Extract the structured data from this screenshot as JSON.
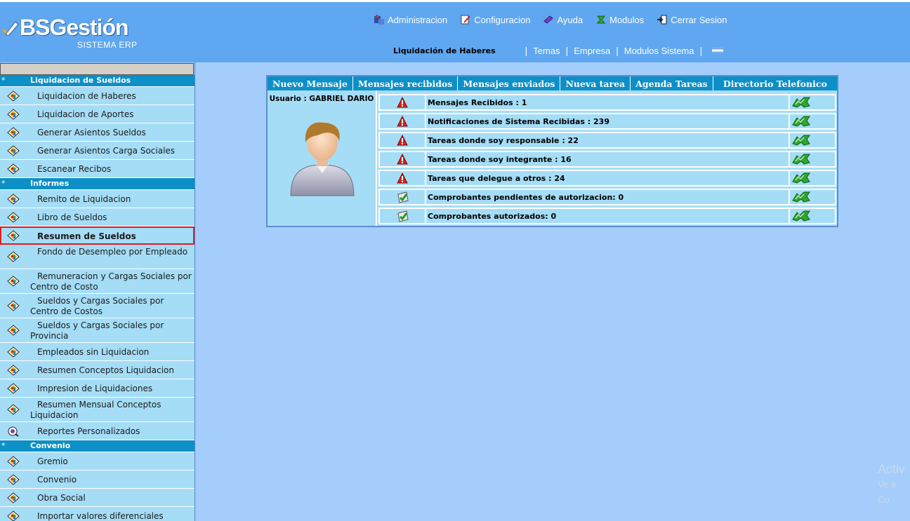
{
  "header": {
    "logo_text": "BSGestión",
    "logo_sub": "SISTEMA ERP",
    "topnav": [
      {
        "label": "Administracion",
        "icon": "admin-icon"
      },
      {
        "label": "Configuracion",
        "icon": "config-icon"
      },
      {
        "label": "Ayuda",
        "icon": "help-icon"
      },
      {
        "label": "Modulos",
        "icon": "modules-icon"
      },
      {
        "label": "Cerrar Sesion",
        "icon": "logout-icon"
      }
    ],
    "current_module": "Liquidación de Haberes",
    "subnav": [
      "Temas",
      "Empresa",
      "Modulos Sistema"
    ],
    "separator": "|"
  },
  "sidebar": {
    "sections": [
      {
        "star": "*",
        "label": "Liquidacion de Sueldos"
      },
      {
        "star": "*",
        "label": "Informes"
      },
      {
        "star": "*",
        "label": "Convenio"
      }
    ],
    "items_liquidacion": [
      "Liquidacion de Haberes",
      "Liquidacion de Aportes",
      "Generar Asientos Sueldos",
      "Generar Asientos Carga Sociales",
      "Escanear Recibos"
    ],
    "items_informes": [
      "Remito de Liquidacion",
      "Libro de Sueldos",
      "Resumen de Sueldos",
      "Fondo de Desempleo por Empleado",
      "Remuneracion y Cargas Sociales por Centro de Costo",
      "Sueldos y Cargas Sociales por Centro de Costos",
      "Sueldos y Cargas Sociales por Provincia",
      "Empleados sin Liquidacion",
      "Resumen Conceptos Liquidacion",
      "Impresion de Liquidaciones",
      "Resumen Mensual Conceptos Liquidacion",
      "Reportes Personalizados"
    ],
    "items_convenio": [
      "Gremio",
      "Convenio",
      "Obra Social",
      "Importar valores diferenciales"
    ],
    "active_item": "Resumen de Sueldos"
  },
  "panel": {
    "tabs": [
      "Nuevo Mensaje",
      "Mensajes recibidos",
      "Mensajes enviados",
      "Nueva tarea",
      "Agenda Tareas",
      "Directorio Telefonico"
    ],
    "user_label": "Usuario : GABRIEL DARIO",
    "rows": [
      {
        "status": "warning",
        "text": "Mensajes Recibidos : 1"
      },
      {
        "status": "warning",
        "text": "Notificaciones de Sistema Recibidas : 239"
      },
      {
        "status": "warning",
        "text": "Tareas donde soy responsable : 22"
      },
      {
        "status": "warning",
        "text": "Tareas donde soy integrante : 16"
      },
      {
        "status": "warning",
        "text": "Tareas que delegue a otros : 24"
      },
      {
        "status": "ok",
        "text": "Comprobantes pendientes de autorizacion: 0"
      },
      {
        "status": "ok",
        "text": "Comprobantes autorizados: 0"
      }
    ]
  },
  "watermark": {
    "line1": "Activ",
    "line2": "Ve a Co"
  },
  "colors": {
    "header": "#5fa7f0",
    "background": "#a5cdfb",
    "section": "#0d8fc7",
    "item": "#a5ddf7",
    "active_border": "#e01b1b"
  }
}
